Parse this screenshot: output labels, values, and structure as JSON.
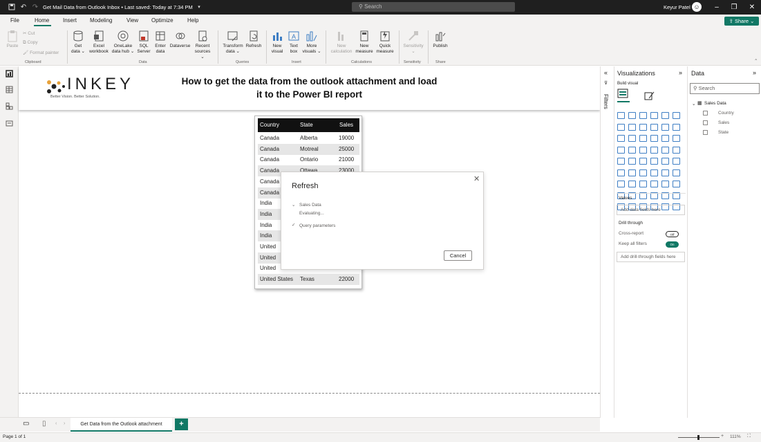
{
  "titlebar": {
    "title": "Get Mail Data from Outlook Inbox • Last saved: Today at 7:34 PM",
    "search_placeholder": "Search",
    "user": "Keyur Patel",
    "icons": [
      "save-icon",
      "undo-icon",
      "redo-icon"
    ]
  },
  "menu": {
    "items": [
      "File",
      "Home",
      "Insert",
      "Modeling",
      "View",
      "Optimize",
      "Help"
    ],
    "active": "Home",
    "share_label": "Share"
  },
  "ribbon": {
    "clipboard": {
      "paste": "Paste",
      "cut": "Cut",
      "copy": "Copy",
      "format_painter": "Format painter",
      "label": "Clipboard"
    },
    "data": {
      "items": [
        {
          "l1": "Get",
          "l2": "data ⌄"
        },
        {
          "l1": "Excel",
          "l2": "workbook"
        },
        {
          "l1": "OneLake",
          "l2": "data hub ⌄"
        },
        {
          "l1": "SQL",
          "l2": "Server"
        },
        {
          "l1": "Enter",
          "l2": "data"
        },
        {
          "l1": "Dataverse",
          "l2": ""
        },
        {
          "l1": "Recent",
          "l2": "sources ⌄"
        }
      ],
      "label": "Data"
    },
    "queries": {
      "items": [
        {
          "l1": "Transform",
          "l2": "data ⌄"
        },
        {
          "l1": "Refresh",
          "l2": ""
        }
      ],
      "label": "Queries"
    },
    "insert": {
      "items": [
        {
          "l1": "New",
          "l2": "visual"
        },
        {
          "l1": "Text",
          "l2": "box"
        },
        {
          "l1": "More",
          "l2": "visuals ⌄"
        }
      ],
      "label": "Insert"
    },
    "calculations": {
      "items": [
        {
          "l1": "New",
          "l2": "calculation"
        },
        {
          "l1": "New",
          "l2": "measure"
        },
        {
          "l1": "Quick",
          "l2": "measure"
        }
      ],
      "label": "Calculations"
    },
    "sensitivity": {
      "items": [
        {
          "l1": "Sensitivity",
          "l2": "⌄"
        }
      ],
      "label": "Sensitivity"
    },
    "share": {
      "items": [
        {
          "l1": "Publish",
          "l2": ""
        }
      ],
      "label": "Share"
    }
  },
  "report": {
    "logo": "INKEY",
    "logo_tagline": "Better Vision. Better Solution.",
    "headline_l1": "How to get the data from the outlook attachment and load",
    "headline_l2": "it to the Power BI report"
  },
  "table": {
    "headers": [
      "Country",
      "State",
      "Sales"
    ],
    "rows": [
      [
        "Canada",
        "Alberta",
        "19000"
      ],
      [
        "Canada",
        "Motreal",
        "25000"
      ],
      [
        "Canada",
        "Ontario",
        "21000"
      ],
      [
        "Canada",
        "Ottawa",
        "23000"
      ],
      [
        "Canada",
        "",
        ""
      ],
      [
        "Canada",
        "",
        ""
      ],
      [
        "India",
        "",
        ""
      ],
      [
        "India",
        "",
        ""
      ],
      [
        "India",
        "",
        ""
      ],
      [
        "India",
        "",
        ""
      ],
      [
        "United",
        "",
        ""
      ],
      [
        "United",
        "",
        ""
      ],
      [
        "United",
        "",
        ""
      ],
      [
        "United States",
        "Texas",
        "22000"
      ]
    ]
  },
  "dialog": {
    "title": "Refresh",
    "item1": "Sales Data",
    "item1_status": "Evaluating...",
    "item2": "Query parameters",
    "cancel": "Cancel"
  },
  "pages": {
    "tab": "Get Data from the Outlook attachment",
    "add": "+"
  },
  "status": {
    "page": "Page 1 of 1",
    "zoom": "111%"
  },
  "filters": {
    "label": "Filters"
  },
  "viz": {
    "title": "Visualizations",
    "build": "Build visual",
    "values_label": "Values",
    "values_placeholder": "Add data fields here",
    "drill_label": "Drill through",
    "cross_report": "Cross-report",
    "cross_report_state": "Off",
    "keep_filters": "Keep all filters",
    "keep_filters_state": "On",
    "drill_placeholder": "Add drill-through fields here"
  },
  "data_pane": {
    "title": "Data",
    "search_placeholder": "Search",
    "table_name": "Sales Data",
    "fields": [
      "Country",
      "Sales",
      "State"
    ]
  },
  "colors": {
    "accent": "#117865",
    "header": "#111111",
    "alt_row": "#e6e6e6"
  }
}
